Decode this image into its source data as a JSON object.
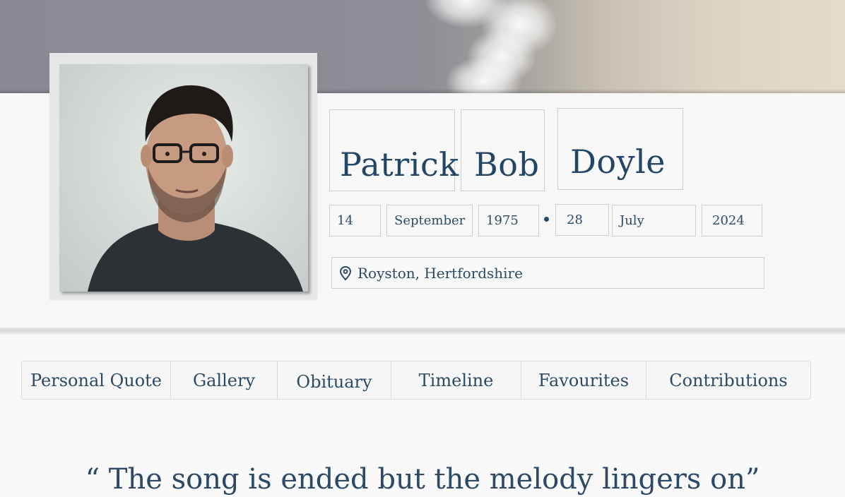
{
  "profile": {
    "first_name": "Patrick",
    "middle_name": "Bob",
    "last_name": "Doyle",
    "birth": {
      "day": "14",
      "month": "September",
      "year": "1975"
    },
    "death": {
      "day": "28",
      "month": "July",
      "year": "2024"
    },
    "location": "Royston, Hertfordshire",
    "location_icon": "map-pin-icon"
  },
  "tabs": [
    {
      "label": "Personal Quote"
    },
    {
      "label": "Gallery"
    },
    {
      "label": "Obituary"
    },
    {
      "label": "Timeline"
    },
    {
      "label": "Favourites"
    },
    {
      "label": "Contributions"
    }
  ],
  "quote": {
    "text": "“ The song is ended but the melody lingers on”"
  },
  "colors": {
    "text": "#2c4a66",
    "background": "#f9f9f9",
    "border": "#cfcfcf"
  }
}
